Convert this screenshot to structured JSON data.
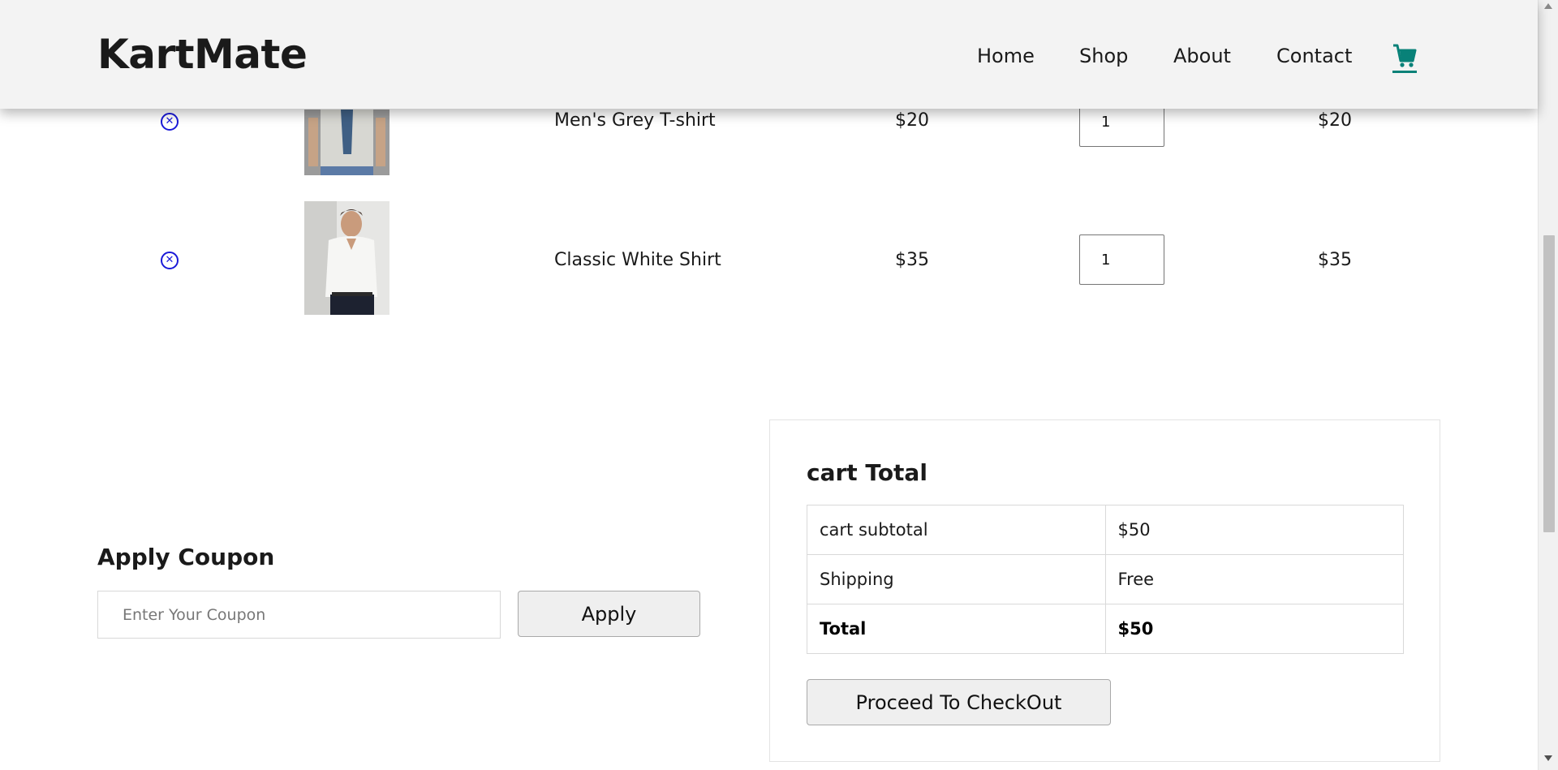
{
  "brand": {
    "name": "KartMate"
  },
  "nav": {
    "items": [
      {
        "label": "Home"
      },
      {
        "label": "Shop"
      },
      {
        "label": "About"
      },
      {
        "label": "Contact"
      }
    ],
    "cart_icon": "shopping-cart-icon",
    "cart_icon_color": "#088178"
  },
  "cart": {
    "items": [
      {
        "name": "Men's Grey T-shirt",
        "price": "$20",
        "quantity": "1",
        "subtotal": "$20"
      },
      {
        "name": "Classic White Shirt",
        "price": "$35",
        "quantity": "1",
        "subtotal": "$35"
      }
    ],
    "remove_icon": "remove-circle-x-icon",
    "remove_icon_color": "#1a19d8"
  },
  "coupon": {
    "title": "Apply Coupon",
    "placeholder": "Enter Your Coupon",
    "button_label": "Apply"
  },
  "totals": {
    "title": "cart Total",
    "rows": [
      {
        "label": "cart subtotal",
        "value": "$50"
      },
      {
        "label": "Shipping",
        "value": "Free"
      },
      {
        "label": "Total",
        "value": "$50"
      }
    ],
    "checkout_label": "Proceed To CheckOut"
  }
}
